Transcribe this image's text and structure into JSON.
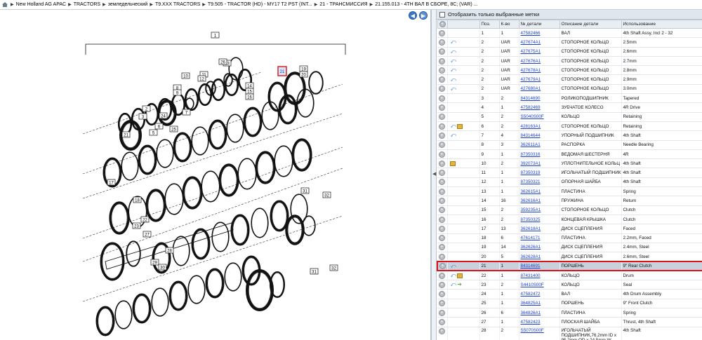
{
  "breadcrumb": [
    "New Holland AG APAC",
    "TRACTORS",
    "земледельческий",
    "T9.XXX TRACTORS",
    "T9.505 - TRACTOR (HD) - MY17 T2 PST (INT...",
    "21 - ТРАНСМИССИЯ",
    "21.155.013 - 4TH ВАЛ В СБОРЕ, 8C; (VAR) ..."
  ],
  "nav": {
    "back": "back",
    "forward": "forward"
  },
  "filter": {
    "label": "Отобразить только выбранные метки"
  },
  "table": {
    "headers": [
      "Поз.",
      "К-во",
      "№ детали",
      "Описание детали",
      "Использование"
    ],
    "rows": [
      {
        "pos": "1",
        "qty": "1",
        "pn": "47582466",
        "desc": "ВАЛ",
        "use": "4th Shaft Assy, Incl 2 - 32",
        "swap": false,
        "box": false,
        "arrow": false
      },
      {
        "pos": "2",
        "qty": "UAR",
        "pn": "427674A1",
        "desc": "СТОПОРНОЕ КОЛЬЦО",
        "use": "2.5mm",
        "swap": true,
        "box": false,
        "arrow": false
      },
      {
        "pos": "2",
        "qty": "UAR",
        "pn": "427675A1",
        "desc": "СТОПОРНОЕ КОЛЬЦО",
        "use": "2.6mm",
        "swap": true,
        "box": false,
        "arrow": false
      },
      {
        "pos": "2",
        "qty": "UAR",
        "pn": "427676A1",
        "desc": "СТОПОРНОЕ КОЛЬЦО",
        "use": "2.7mm",
        "swap": true,
        "box": false,
        "arrow": false
      },
      {
        "pos": "2",
        "qty": "UAR",
        "pn": "427678A1",
        "desc": "СТОПОРНОЕ КОЛЬЦО",
        "use": "2.8mm",
        "swap": true,
        "box": false,
        "arrow": false
      },
      {
        "pos": "2",
        "qty": "UAR",
        "pn": "427679A1",
        "desc": "СТОПОРНОЕ КОЛЬЦО",
        "use": "2.9mm",
        "swap": true,
        "box": false,
        "arrow": false
      },
      {
        "pos": "2",
        "qty": "UAR",
        "pn": "427680A1",
        "desc": "СТОПОРНОЕ КОЛЬЦО",
        "use": "3.0mm",
        "swap": true,
        "box": false,
        "arrow": false
      },
      {
        "pos": "3",
        "qty": "2",
        "pn": "84314690",
        "desc": "РОЛИКОПОДШИПНИК",
        "use": "Tapered",
        "swap": false,
        "box": false,
        "arrow": false
      },
      {
        "pos": "4",
        "qty": "1",
        "pn": "47582469",
        "desc": "ЗУБЧАТОЕ КОЛЕСО",
        "use": "4R Drive",
        "swap": false,
        "box": false,
        "arrow": false
      },
      {
        "pos": "5",
        "qty": "2",
        "pn": "S5040S00F",
        "desc": "КОЛЬЦО",
        "use": "Retaining",
        "swap": false,
        "box": false,
        "arrow": false
      },
      {
        "pos": "6",
        "qty": "2",
        "pn": "428163A1",
        "desc": "СТОПОРНОЕ КОЛЬЦО",
        "use": "Retaining",
        "swap": true,
        "box": true,
        "arrow": false
      },
      {
        "pos": "7",
        "qty": "4",
        "pn": "84314644",
        "desc": "УПОРНЫЙ ПОДШИПНИК",
        "use": "4th Shaft",
        "swap": true,
        "box": false,
        "arrow": false
      },
      {
        "pos": "8",
        "qty": "3",
        "pn": "362611A1",
        "desc": "РАСПОРКА",
        "use": "Needle Bearing",
        "swap": false,
        "box": false,
        "arrow": false
      },
      {
        "pos": "9",
        "qty": "1",
        "pn": "87350316",
        "desc": "ВЕДОМАЯ ШЕСТЕРНЯ",
        "use": "4R",
        "swap": false,
        "box": false,
        "arrow": false
      },
      {
        "pos": "10",
        "qty": "2",
        "pn": "392073A1",
        "desc": "УПЛОТНИТЕЛЬНОЕ КОЛЬЦ",
        "use": "4th Shaft",
        "swap": false,
        "box": true,
        "arrow": false
      },
      {
        "pos": "11",
        "qty": "1",
        "pn": "87350319",
        "desc": "ИГОЛЬЧАТЫЙ ПОДШИПНИК",
        "use": "4th Shaft",
        "swap": false,
        "box": false,
        "arrow": false
      },
      {
        "pos": "12",
        "qty": "1",
        "pn": "87350321",
        "desc": "ОПОРНАЯ ШАЙБА",
        "use": "4th Shaft",
        "swap": false,
        "box": false,
        "arrow": false
      },
      {
        "pos": "13",
        "qty": "1",
        "pn": "362615A1",
        "desc": "ПЛАСТИНА",
        "use": "Spring",
        "swap": false,
        "box": false,
        "arrow": false
      },
      {
        "pos": "14",
        "qty": "16",
        "pn": "362616A1",
        "desc": "ПРУЖИНА",
        "use": "Return",
        "swap": false,
        "box": false,
        "arrow": false
      },
      {
        "pos": "15",
        "qty": "2",
        "pn": "359235A1",
        "desc": "СТОПОРНОЕ КОЛЬЦО",
        "use": "Clutch",
        "swap": false,
        "box": false,
        "arrow": false
      },
      {
        "pos": "16",
        "qty": "2",
        "pn": "87350325",
        "desc": "КОНЦЕВАЯ КРЫШКА",
        "use": "Clutch",
        "swap": false,
        "box": false,
        "arrow": false
      },
      {
        "pos": "17",
        "qty": "13",
        "pn": "362618A1",
        "desc": "ДИСК СЦЕПЛЕНИЯ",
        "use": "Faced",
        "swap": false,
        "box": false,
        "arrow": false
      },
      {
        "pos": "18",
        "qty": "6",
        "pn": "47614171",
        "desc": "ПЛАСТИНА",
        "use": "2.2mm, Faced",
        "swap": false,
        "box": false,
        "arrow": false
      },
      {
        "pos": "19",
        "qty": "14",
        "pn": "362626A1",
        "desc": "ДИСК СЦЕПЛЕНИЯ",
        "use": "2.4mm, Steel",
        "swap": false,
        "box": false,
        "arrow": false
      },
      {
        "pos": "20",
        "qty": "5",
        "pn": "362628A1",
        "desc": "ДИСК СЦЕПЛЕНИЯ",
        "use": "2.6mm, Steel",
        "swap": false,
        "box": false,
        "arrow": false
      },
      {
        "pos": "21",
        "qty": "1",
        "pn": "84314691",
        "desc": "ПОРШЕНЬ",
        "use": "9\" Rear Clutch",
        "swap": true,
        "box": false,
        "arrow": false,
        "selected": true
      },
      {
        "pos": "22",
        "qty": "1",
        "pn": "87431400",
        "desc": "КОЛЬЦО",
        "use": "Drum",
        "swap": true,
        "box": true,
        "arrow": false
      },
      {
        "pos": "23",
        "qty": "2",
        "pn": "S4410S00F",
        "desc": "КОЛЬЦО",
        "use": "Seal",
        "swap": true,
        "box": false,
        "arrow": true
      },
      {
        "pos": "24",
        "qty": "1",
        "pn": "47582472",
        "desc": "ВАЛ",
        "use": "4th Drum Assembly",
        "swap": false,
        "box": false,
        "arrow": false
      },
      {
        "pos": "25",
        "qty": "1",
        "pn": "364825A1",
        "desc": "ПОРШЕНЬ",
        "use": "9\" Front Clutch",
        "swap": false,
        "box": false,
        "arrow": false
      },
      {
        "pos": "26",
        "qty": "6",
        "pn": "364826A1",
        "desc": "ПЛАСТИНА",
        "use": "Spring",
        "swap": false,
        "box": false,
        "arrow": false
      },
      {
        "pos": "27",
        "qty": "1",
        "pn": "47582423",
        "desc": "ПЛОСКАЯ ШАЙБА",
        "use": "Thrust, 4th Shaft",
        "swap": false,
        "box": false,
        "arrow": false
      },
      {
        "pos": "28",
        "qty": "2",
        "pn": "S5070S00F",
        "desc": "ИГОЛЬЧАТЫЙ ПОДШИПНИК,76.2mm ID x 95.2mm OD x 24.5mm W",
        "use": "4th Shaft",
        "swap": false,
        "box": false,
        "arrow": false,
        "tall": true
      }
    ]
  },
  "diagram": {
    "callouts": [
      "1",
      "2",
      "3",
      "4",
      "5",
      "6",
      "7",
      "8",
      "9",
      "10",
      "11",
      "12",
      "13",
      "14",
      "15",
      "16",
      "17",
      "18",
      "19",
      "20",
      "21",
      "22",
      "23",
      "24",
      "25",
      "26",
      "27",
      "28",
      "29",
      "30",
      "31",
      "32"
    ],
    "highlighted": "21"
  }
}
